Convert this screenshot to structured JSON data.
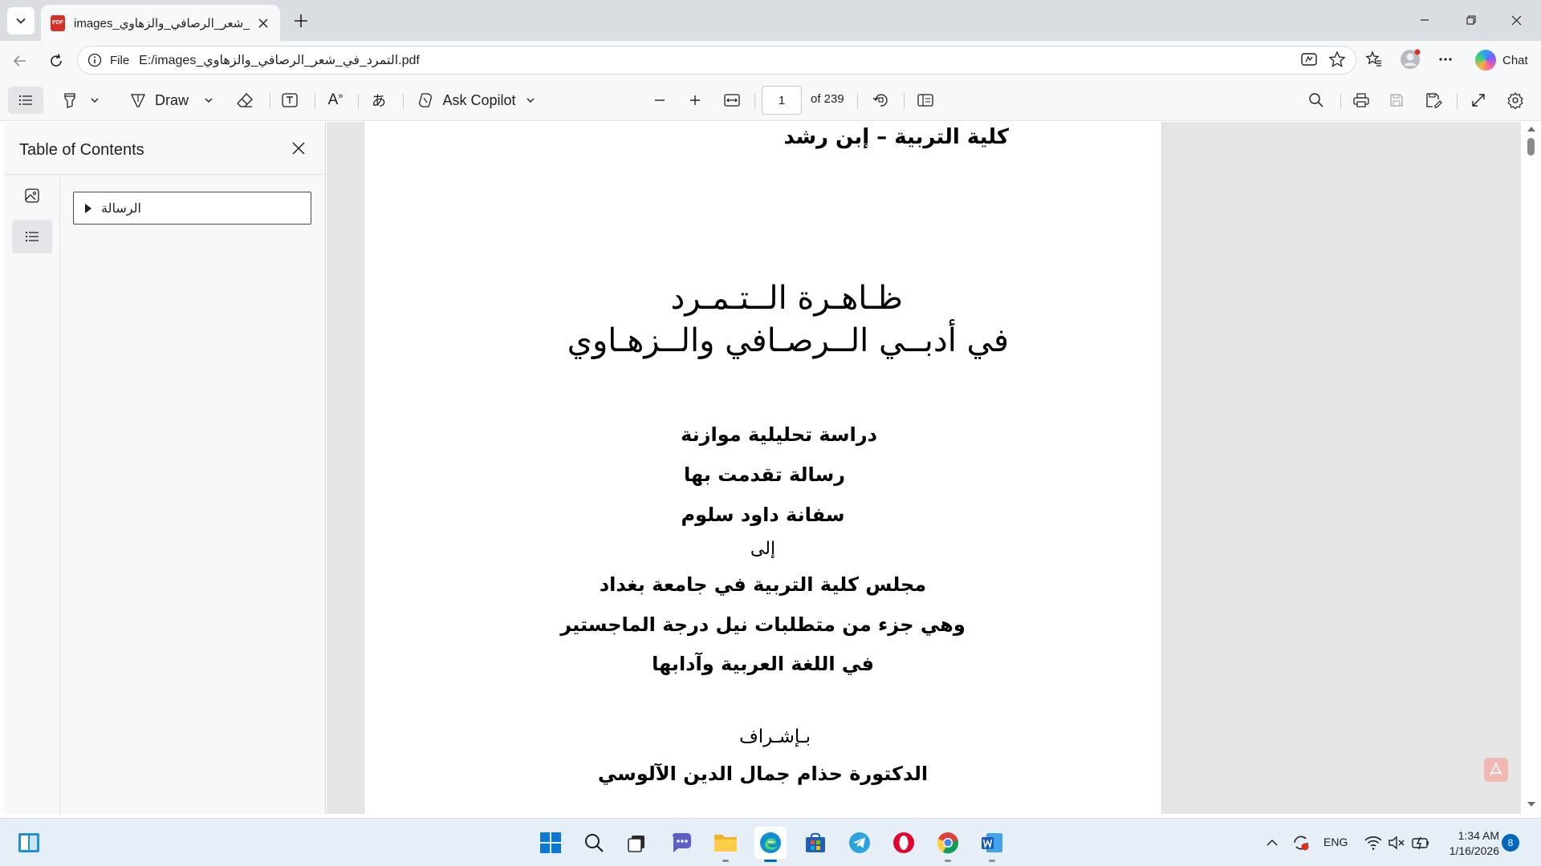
{
  "browser": {
    "tab": {
      "title": "images_التمرد_في_شعر_الرصافي_والزهاوي",
      "icon": "pdf-icon",
      "icon_text": "PDF"
    },
    "address": {
      "scheme_label": "File",
      "url": "E:/images_التمرد_في_شعر_الرصافي_والزهاوي.pdf"
    },
    "chat_label": "Chat"
  },
  "pdf_toolbar": {
    "draw_label": "Draw",
    "ask_copilot_label": "Ask Copilot",
    "read_aloud_label": "A",
    "translate_label": "あ",
    "page_current": "1",
    "page_total": "of 239"
  },
  "sidebar": {
    "title": "Table of Contents",
    "items": [
      {
        "label": "الرسالة",
        "expanded": false
      }
    ]
  },
  "document": {
    "lines": [
      "كلية التربية – إبن رشد",
      "ظـاهـرة الــتـمـرد",
      "في أدبــي الــرصـافي والــزهـاوي",
      "دراسة تحليلية موازنة",
      "رسالة تقدمت بها",
      "سفانة داود سلوم",
      "إلى",
      "مجلس كلية التربية في جامعة بغداد",
      "وهي جزء من متطلبات نيل درجة الماجستير",
      "في اللغة العربية وآدابها",
      "بـإشـراف",
      "الدكتورة حذام جمال الدين الآلوسي"
    ]
  },
  "taskbar": {
    "language": "ENG",
    "time": "1:34 AM",
    "date": "1/16/2026",
    "notification_count": "8"
  },
  "colors": {
    "accent": "#0067c0",
    "tab_bar": "#dadee3",
    "toolbar": "#f7f8fa",
    "viewer_bg": "#e6e6e6",
    "pdf_red": "#d93025"
  }
}
